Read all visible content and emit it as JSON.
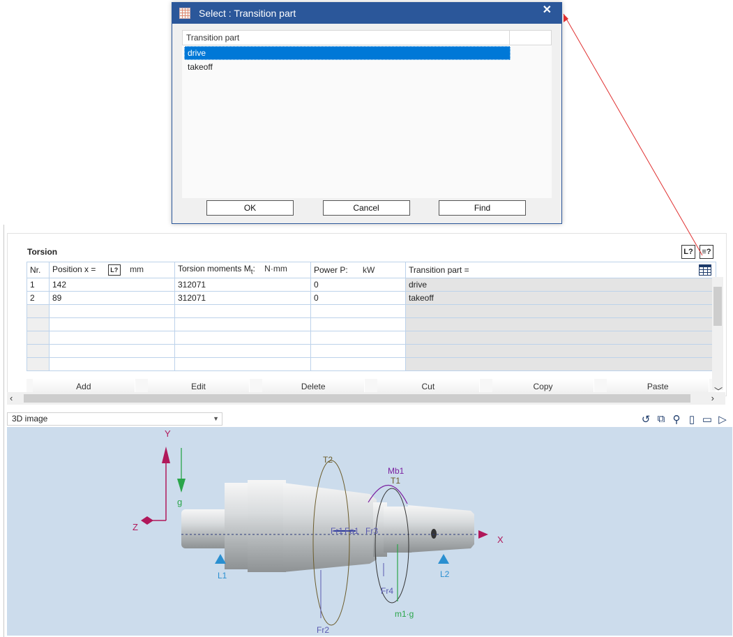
{
  "dialog": {
    "title": "Select : Transition part",
    "close_glyph": "✕",
    "column_header": "Transition part",
    "items": [
      "drive",
      "takeoff"
    ],
    "selected": "drive",
    "buttons": {
      "ok": "OK",
      "cancel": "Cancel",
      "find": "Find"
    }
  },
  "torsion": {
    "title": "Torsion",
    "columns": {
      "nr": "Nr.",
      "position": "Position x =",
      "position_unit": "mm",
      "torsion": "Torsion moments M",
      "torsion_sub": "t",
      "torsion_suffix": ":",
      "torsion_unit": "N·mm",
      "power": "Power P:",
      "power_unit": "kW",
      "transition": "Transition  part ="
    },
    "rows": [
      {
        "nr": "1",
        "position": "142",
        "torsion": "312071",
        "power": "0",
        "transition": "drive"
      },
      {
        "nr": "2",
        "position": "89",
        "torsion": "312071",
        "power": "0",
        "transition": "takeoff"
      }
    ],
    "buttons": {
      "add": "Add",
      "edit": "Edit",
      "delete": "Delete",
      "cut": "Cut",
      "copy": "Copy",
      "paste": "Paste"
    }
  },
  "view": {
    "select_value": "3D image",
    "labels": {
      "y": "Y",
      "z": "Z",
      "x": "X",
      "g": "g",
      "t2": "T2",
      "t1": "T1",
      "mb1": "Mb1",
      "fr1": "Fr1",
      "fa1": "Fa1",
      "fr3": "Fr3",
      "fr4": "Fr4",
      "fr2": "Fr2",
      "mg": "m1·g",
      "l1": "L1",
      "l2": "L2"
    }
  },
  "colors": {
    "accent": "#2b579a",
    "selection": "#0078d7",
    "viewport": "#ccdcec",
    "axis": "#b0185a"
  }
}
